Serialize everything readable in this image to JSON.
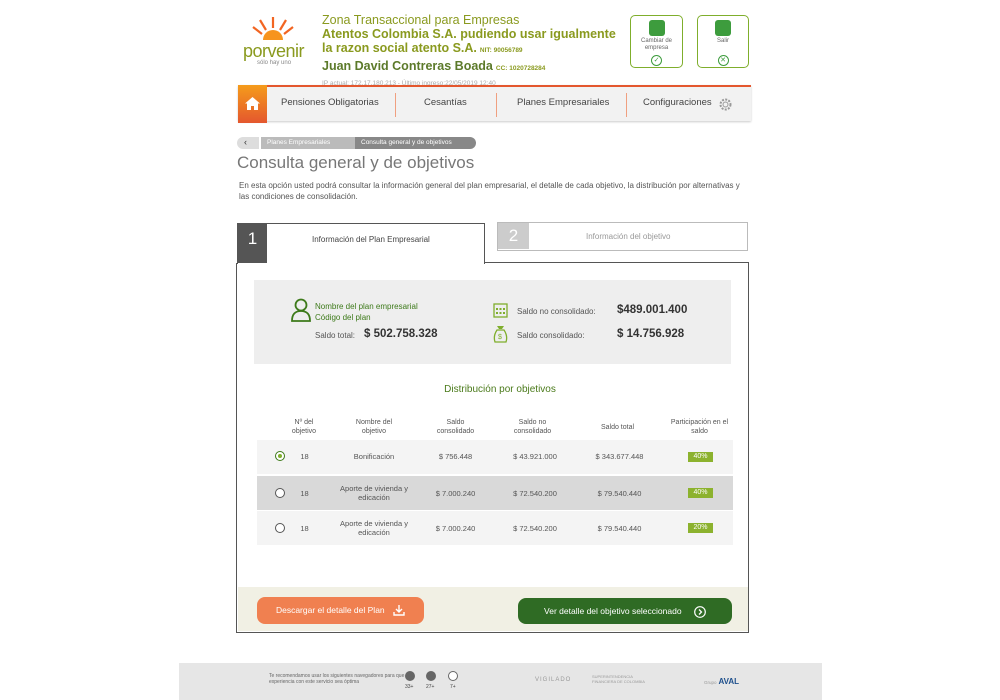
{
  "brand": {
    "name": "porvenir",
    "tagline": "sólo hay uno"
  },
  "header": {
    "zone": "Zona Transaccional para Empresas",
    "company_line1": "Atentos Colombia S.A. pudiendo usar igualmente",
    "company_line2": "la razon social atento S.A.",
    "nit_label": "NIT: 90056789",
    "user_name": "Juan David Contreras Boada",
    "cc_label": "CC: 1020728284",
    "ip_info": "IP actual: 172.17.180.213 - Último ingreso:22/05/2019 12:40",
    "change_company": "Cambiar de empresa",
    "logout": "Salir"
  },
  "nav": {
    "items": [
      "Pensiones Obligatorias",
      "Cesantías",
      "Planes Empresariales",
      "Configuraciones"
    ]
  },
  "breadcrumb": [
    "Planes Empresariales",
    "Consulta general y de objetivos"
  ],
  "page": {
    "title": "Consulta general y de objetivos",
    "description": "En esta opción usted podrá consultar la información general del plan empresarial, el detalle de cada objetivo, la distribución por alternativas y las condiciones de consolidación."
  },
  "tabs": [
    {
      "number": "1",
      "label": "Información del Plan Empresarial"
    },
    {
      "number": "2",
      "label": "Información del objetivo"
    }
  ],
  "summary": {
    "plan_name_label": "Nombre del plan empresarial",
    "plan_code_label": "Código del plan",
    "total_label": "Saldo total:",
    "total_value": "$ 502.758.328",
    "unconsolidated_label": "Saldo no consolidado:",
    "unconsolidated_value": "$489.001.400",
    "consolidated_label": "Saldo consolidado:",
    "consolidated_value": "$ 14.756.928"
  },
  "distribution": {
    "title": "Distribución por objetivos",
    "headers": [
      "Nº del objetivo",
      "Nombre del objetivo",
      "Saldo consolidado",
      "Saldo no consolidado",
      "Saldo total",
      "Participación en el saldo"
    ],
    "rows": [
      {
        "number": "18",
        "name": "Bonificación",
        "consolidated": "$ 756.448",
        "unconsolidated": "$ 43.921.000",
        "total": "$ 343.677.448",
        "share": "40%",
        "selected": true
      },
      {
        "number": "18",
        "name": "Aporte de vivienda y edicación",
        "consolidated": "$ 7.000.240",
        "unconsolidated": "$ 72.540.200",
        "total": "$ 79.540.440",
        "share": "40%",
        "selected": false
      },
      {
        "number": "18",
        "name": "Aporte de vivienda y edicación",
        "consolidated": "$ 7.000.240",
        "unconsolidated": "$ 72.540.200",
        "total": "$ 79.540.440",
        "share": "20%",
        "selected": false
      }
    ]
  },
  "actions": {
    "download": "Descargar el detalle del Plan",
    "view_detail": "Ver detalle del objetivo seleccionado"
  },
  "footer": {
    "browsers_note": "Te recomendamos usar los siguientes navegadores para que tu experiencia con este servicio sea óptima",
    "browser_versions": [
      "33+",
      "27+",
      "7+"
    ],
    "vigilado": "VIGILADO",
    "superintendencia": "SUPERINTENDENCIA FINANCIERA DE COLOMBIA",
    "grupo": "Grupo",
    "aval": "AVAL"
  },
  "colors": {
    "accent": "#e4572e",
    "brand_green": "#8a9a1f",
    "dark_green": "#2f6b24",
    "orange": "#f08050"
  }
}
